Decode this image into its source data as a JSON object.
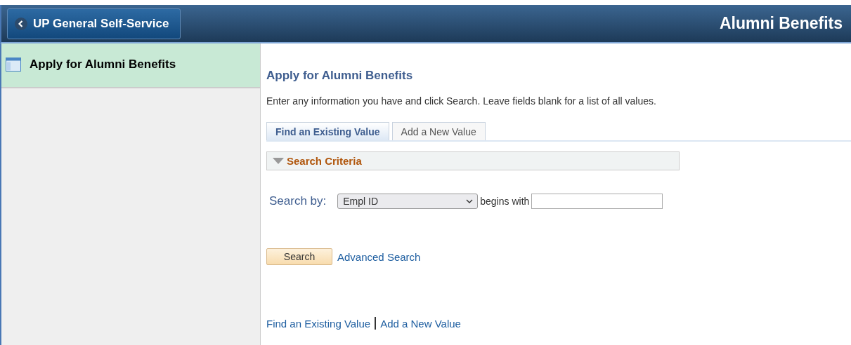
{
  "header": {
    "back_button": "UP General Self-Service",
    "title": "Alumni Benefits"
  },
  "sidebar": {
    "items": [
      {
        "label": "Apply for Alumni Benefits",
        "selected": true
      }
    ]
  },
  "page": {
    "heading": "Apply for Alumni Benefits",
    "instructions": "Enter any information you have and click Search. Leave fields blank for a list of all values.",
    "tabs": [
      {
        "label": "Find an Existing Value",
        "selected": true
      },
      {
        "label": "Add a New Value",
        "selected": false
      }
    ],
    "section": {
      "title": "Search Criteria",
      "expanded": true
    },
    "search_by_label": "Search by:",
    "search_by_value": "Empl ID",
    "operator": "begins with",
    "search_button": "Search",
    "advanced_link": "Advanced Search",
    "footer_links": [
      "Find an Existing Value",
      "Add a New Value"
    ]
  }
}
